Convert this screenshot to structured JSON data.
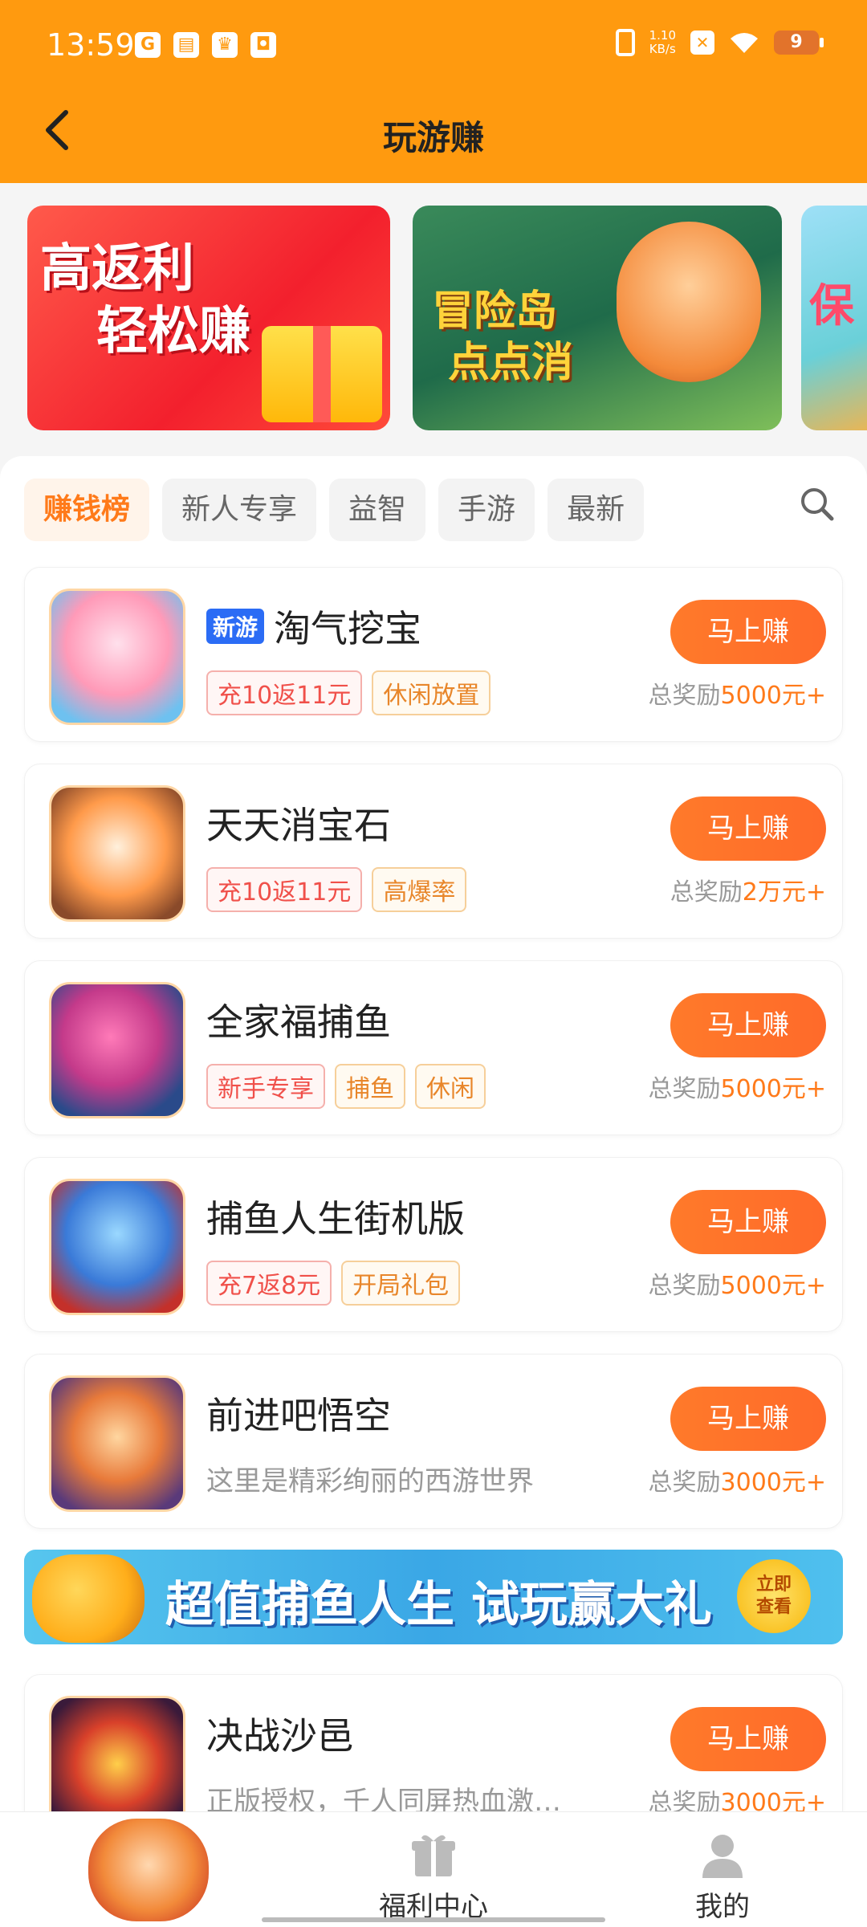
{
  "status_bar": {
    "time": "13:59",
    "net_speed_value": "1.10",
    "net_speed_unit": "KB/s",
    "battery": "9"
  },
  "header": {
    "title": "玩游赚"
  },
  "banners": [
    {
      "line1": "高返利",
      "line2": "轻松赚"
    },
    {
      "line1": "冒险岛",
      "line2": "点点消"
    },
    {
      "text": "保"
    }
  ],
  "tabs": [
    {
      "label": "赚钱榜",
      "active": true
    },
    {
      "label": "新人专享"
    },
    {
      "label": "益智"
    },
    {
      "label": "手游"
    },
    {
      "label": "最新"
    }
  ],
  "games": [
    {
      "badge": "新游",
      "name": "淘气挖宝",
      "tags": [
        {
          "text": "充10返11元",
          "style": "r"
        },
        {
          "text": "休闲放置",
          "style": "o"
        }
      ],
      "button": "马上赚",
      "reward_prefix": "总奖励",
      "reward_value": "5000元+"
    },
    {
      "name": "天天消宝石",
      "tags": [
        {
          "text": "充10返11元",
          "style": "r"
        },
        {
          "text": "高爆率",
          "style": "o"
        }
      ],
      "button": "马上赚",
      "reward_prefix": "总奖励",
      "reward_value": "2万元+"
    },
    {
      "name": "全家福捕鱼",
      "tags": [
        {
          "text": "新手专享",
          "style": "r"
        },
        {
          "text": "捕鱼",
          "style": "o"
        },
        {
          "text": "休闲",
          "style": "o"
        }
      ],
      "button": "马上赚",
      "reward_prefix": "总奖励",
      "reward_value": "5000元+"
    },
    {
      "name": "捕鱼人生街机版",
      "tags": [
        {
          "text": "充7返8元",
          "style": "r"
        },
        {
          "text": "开局礼包",
          "style": "o"
        }
      ],
      "button": "马上赚",
      "reward_prefix": "总奖励",
      "reward_value": "5000元+"
    },
    {
      "name": "前进吧悟空",
      "desc": "这里是精彩绚丽的西游世界",
      "button": "马上赚",
      "reward_prefix": "总奖励",
      "reward_value": "3000元+"
    }
  ],
  "promo": {
    "text": "超值捕鱼人生 试玩赢大礼",
    "button_line1": "立即",
    "button_line2": "查看"
  },
  "last_game": {
    "name": "决战沙邑",
    "desc": "正版授权，千人同屏热血激…",
    "button": "马上赚",
    "reward_prefix": "总奖励",
    "reward_value": "3000元+"
  },
  "bottom_nav": [
    {
      "label": ""
    },
    {
      "label": "福利中心"
    },
    {
      "label": "我的"
    }
  ]
}
